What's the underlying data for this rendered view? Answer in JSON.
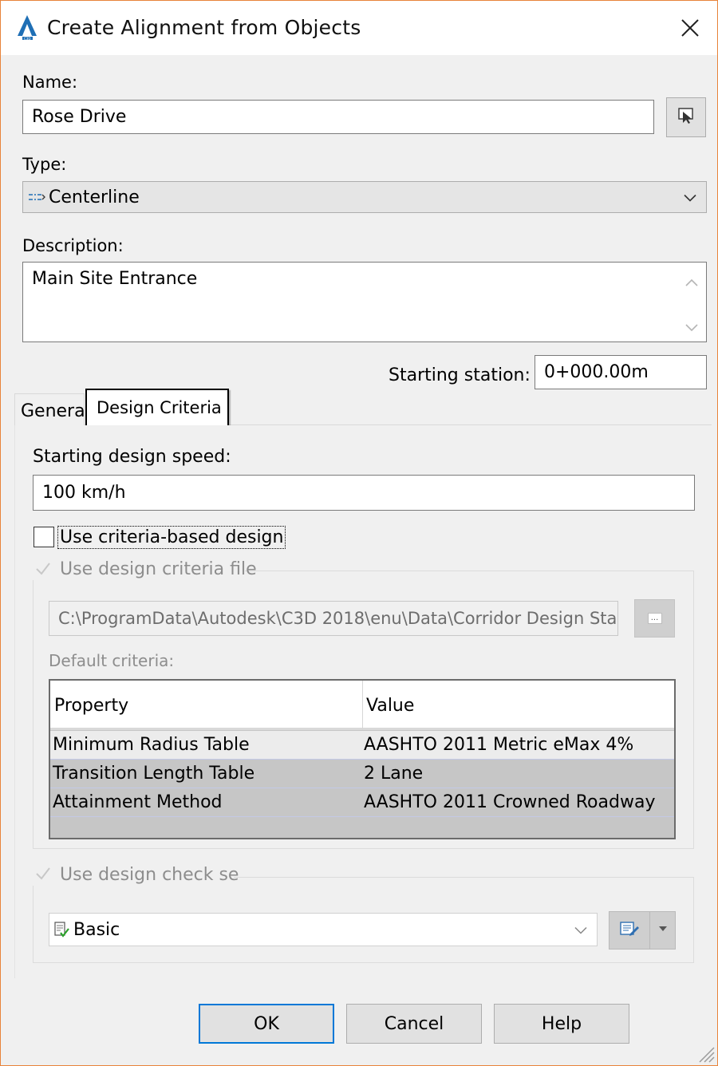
{
  "window": {
    "title": "Create Alignment from Objects"
  },
  "name": {
    "label": "Name:",
    "value": "Rose Drive"
  },
  "type": {
    "label": "Type:",
    "value": "Centerline"
  },
  "description": {
    "label": "Description:",
    "value": "Main Site Entrance"
  },
  "starting_station": {
    "label": "Starting station:",
    "value": "0+000.00m"
  },
  "tabs": [
    {
      "label": "General",
      "selected": false
    },
    {
      "label": "Design Criteria",
      "selected": true
    }
  ],
  "design_criteria": {
    "speed_label": "Starting design speed:",
    "speed_value": "100 km/h",
    "use_criteria_label": "Use criteria-based design",
    "use_criteria_checked": false,
    "use_file_label": "Use design criteria file",
    "use_file_checked": true,
    "file_path": "C:\\ProgramData\\Autodesk\\C3D 2018\\enu\\Data\\Corridor Design Sta",
    "browse_label": "...",
    "default_criteria_label": "Default criteria:",
    "table": {
      "headers": [
        "Property",
        "Value"
      ],
      "rows": [
        {
          "property": "Minimum Radius Table",
          "value": "AASHTO 2011 Metric eMax 4%"
        },
        {
          "property": "Transition Length Table",
          "value": "2 Lane"
        },
        {
          "property": "Attainment Method",
          "value": "AASHTO 2011 Crowned Roadway"
        }
      ]
    },
    "use_check_set_label": "Use design check se",
    "use_check_set_checked": true,
    "check_set_value": "Basic"
  },
  "buttons": {
    "ok": "OK",
    "cancel": "Cancel",
    "help": "Help"
  },
  "colors": {
    "accent": "#0078d7",
    "window_border": "#e8833a",
    "autodesk_blue": "#1f6fb5"
  }
}
